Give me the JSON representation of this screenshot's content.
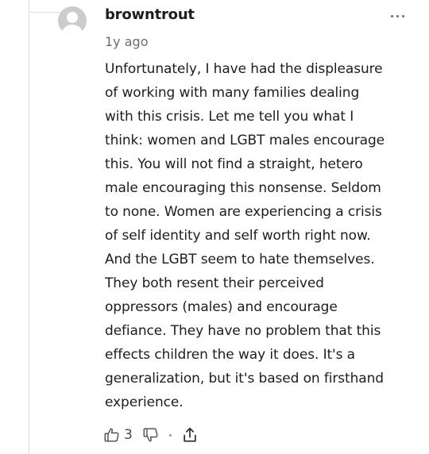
{
  "comment": {
    "username": "browntrout",
    "timestamp": "1y ago",
    "text": "Unfortunately, I have had the displeasure\nof working with many families dealing\nwith this crisis.  Let me tell you  what I\nthink:  women and LGBT males encourage\nthis.  You will not find a straight, hetero\nmale encouraging this nonsense.  Seldom\nto none.   Women are experiencing a crisis\nof self identity and self worth right now.\nAnd the LGBT seem to hate themselves.\nThey both resent their perceived\noppressors (males) and encourage\ndefiance.  They have  no problem that this\neffects children the way it does.  It's a\ngeneralization, but it's based  on firsthand\nexperience.",
    "likes": "3"
  },
  "icons": {
    "avatar": "user-avatar-placeholder",
    "more": "more-options-icon",
    "like": "thumbs-up-icon",
    "dislike": "thumbs-down-icon",
    "share": "share-icon"
  },
  "colors": {
    "text": "#1d1d1f",
    "muted": "#6b6b6b",
    "avatar_bg": "#c9ccd1",
    "thread_line": "#dcdcdc"
  }
}
